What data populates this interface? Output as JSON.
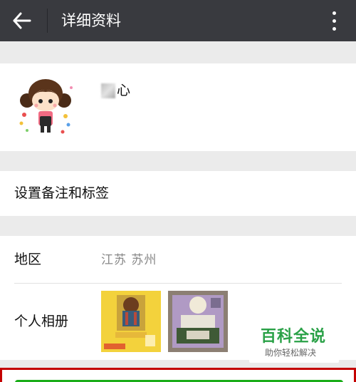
{
  "header": {
    "title": "详细资料",
    "back_icon": "arrow-left-icon",
    "more_icon": "more-vertical-icon"
  },
  "profile": {
    "nickname": "心",
    "avatar_icon": "cartoon-girl-avatar"
  },
  "remark": {
    "label": "设置备注和标签"
  },
  "region": {
    "label": "地区",
    "value": "江苏 苏州"
  },
  "album": {
    "label": "个人相册"
  },
  "watermark": {
    "main": "百科全说",
    "sub": "助你轻松解决"
  },
  "colors": {
    "topbar": "#393a3f",
    "background": "#ebebeb",
    "accent_green": "#1aad19",
    "highlight_red": "#c40000"
  }
}
